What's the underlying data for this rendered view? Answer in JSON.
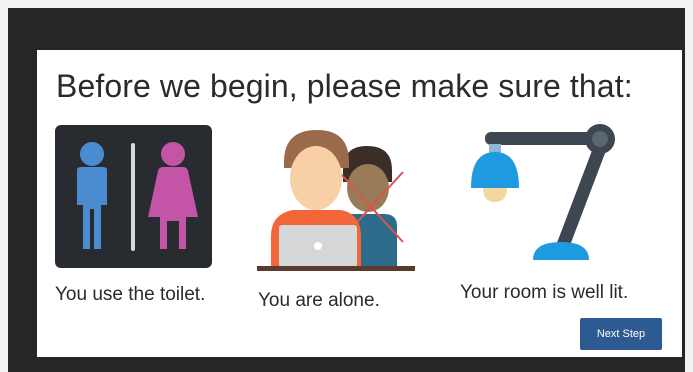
{
  "instructions": {
    "title": "Before we begin, please make sure that:",
    "requirements": [
      {
        "caption": "You use the toilet.",
        "icon": "restroom-icon"
      },
      {
        "caption": "You are alone.",
        "icon": "alone-person-icon"
      },
      {
        "caption": "Your room is well lit.",
        "icon": "desk-lamp-icon"
      }
    ],
    "next_button_label": "Next Step"
  },
  "colors": {
    "frame": "#262626",
    "card": "#ffffff",
    "button": "#2e5a93",
    "male_icon": "#4a8ccf",
    "female_icon": "#c455a6",
    "lamp_shade": "#1e9be0"
  }
}
